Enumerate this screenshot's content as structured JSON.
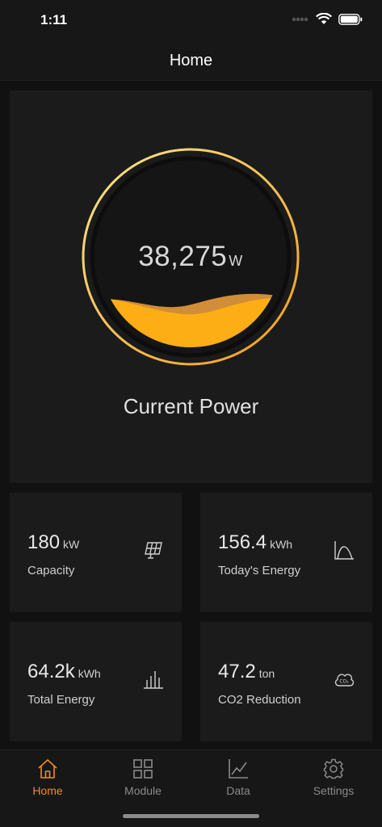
{
  "status_bar": {
    "time": "1:11"
  },
  "nav": {
    "title": "Home"
  },
  "hero": {
    "power_value": "38,275",
    "power_unit": "W",
    "label": "Current Power",
    "fill_level": 0.28,
    "accent_start": "#fde58a",
    "accent_end": "#f59c1b"
  },
  "stats": [
    {
      "value": "180",
      "unit": "kW",
      "label": "Capacity",
      "icon": "solar-panel-icon"
    },
    {
      "value": "156.4",
      "unit": "kWh",
      "label": "Today's Energy",
      "icon": "bell-curve-icon"
    },
    {
      "value": "64.2k",
      "unit": "kWh",
      "label": "Total Energy",
      "icon": "bar-chart-icon"
    },
    {
      "value": "47.2",
      "unit": "ton",
      "label": "CO2 Reduction",
      "icon": "co2-cloud-icon"
    }
  ],
  "tabs": [
    {
      "label": "Home",
      "icon": "home-icon",
      "active": true
    },
    {
      "label": "Module",
      "icon": "grid-icon",
      "active": false
    },
    {
      "label": "Data",
      "icon": "line-chart-icon",
      "active": false
    },
    {
      "label": "Settings",
      "icon": "gear-icon",
      "active": false
    }
  ],
  "colors": {
    "background": "#111111",
    "card": "#1b1b1b",
    "active_tab": "#f08a2b",
    "inactive_tab": "#8a8a8a"
  }
}
